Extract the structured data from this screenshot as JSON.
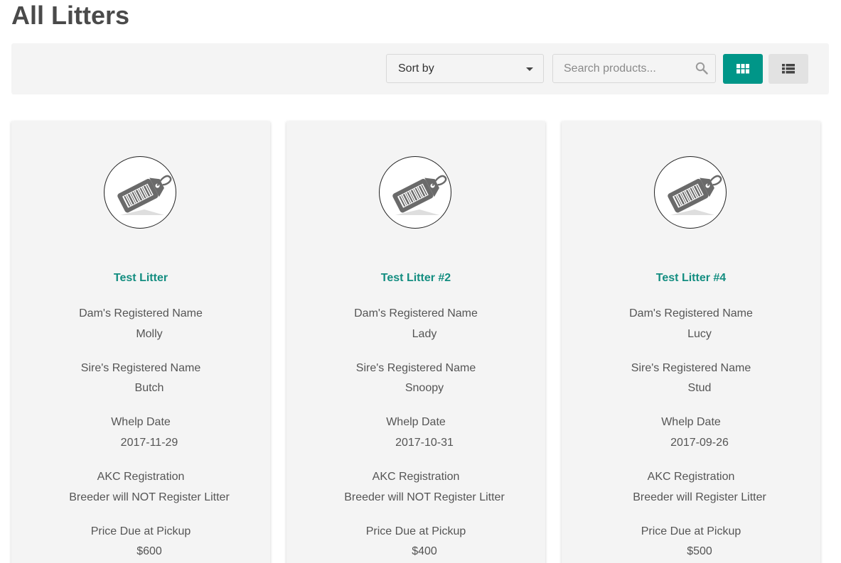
{
  "page": {
    "title": "All Litters"
  },
  "toolbar": {
    "sort_label": "Sort by",
    "search_placeholder": "Search products...",
    "accent_color": "#009688"
  },
  "fields": {
    "dam_label": "Dam's Registered Name",
    "sire_label": "Sire's Registered Name",
    "whelp_label": "Whelp Date",
    "akc_label": "AKC Registration",
    "price_label": "Price Due at Pickup"
  },
  "cards": [
    {
      "title": "Test Litter",
      "image_icon": "price-tag-barcode-icon",
      "dam": "Molly",
      "sire": "Butch",
      "whelp_date": "2017-11-29",
      "akc": "Breeder will NOT Register Litter",
      "price": "$600"
    },
    {
      "title": "Test Litter #2",
      "image_icon": "price-tag-barcode-icon",
      "dam": "Lady",
      "sire": "Snoopy",
      "whelp_date": "2017-10-31",
      "akc": "Breeder will NOT Register Litter",
      "price": "$400"
    },
    {
      "title": "Test Litter #4",
      "image_icon": "price-tag-barcode-icon",
      "dam": "Lucy",
      "sire": "Stud",
      "whelp_date": "2017-09-26",
      "akc": "Breeder will Register Litter",
      "price": "$500"
    }
  ]
}
